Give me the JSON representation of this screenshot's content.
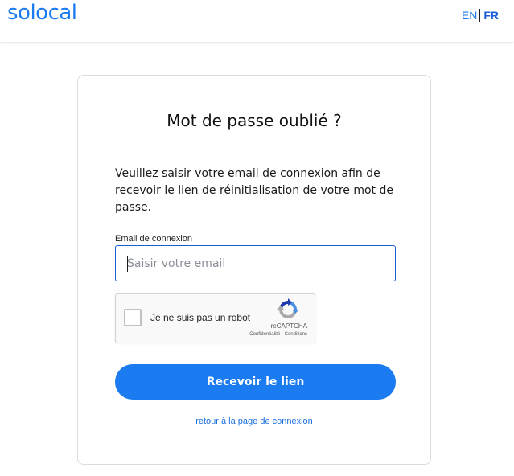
{
  "header": {
    "logo_text": "solocal",
    "languages": {
      "en_label": "EN",
      "fr_label": "FR",
      "active": "FR"
    }
  },
  "card": {
    "title": "Mot de passe oublié ?",
    "intro": "Veuillez saisir votre email de connexion afin de recevoir le lien de réinitialisation de votre mot de passe.",
    "email_field": {
      "label": "Email de connexion",
      "placeholder": "Saisir votre email",
      "value": ""
    },
    "recaptcha": {
      "label": "Je ne suis pas un robot",
      "brand": "reCAPTCHA",
      "links": "Confidentialité - Conditions",
      "checked": false
    },
    "submit_label": "Recevoir le lien",
    "back_link_label": "retour à la page de connexion"
  },
  "colors": {
    "brand_blue": "#1b7bf0",
    "link_blue": "#1b6fe0",
    "field_border": "#1b5fd6",
    "card_border": "#dcdcdc"
  },
  "icons": {
    "recaptcha_logo": "recaptcha-logo-icon"
  }
}
